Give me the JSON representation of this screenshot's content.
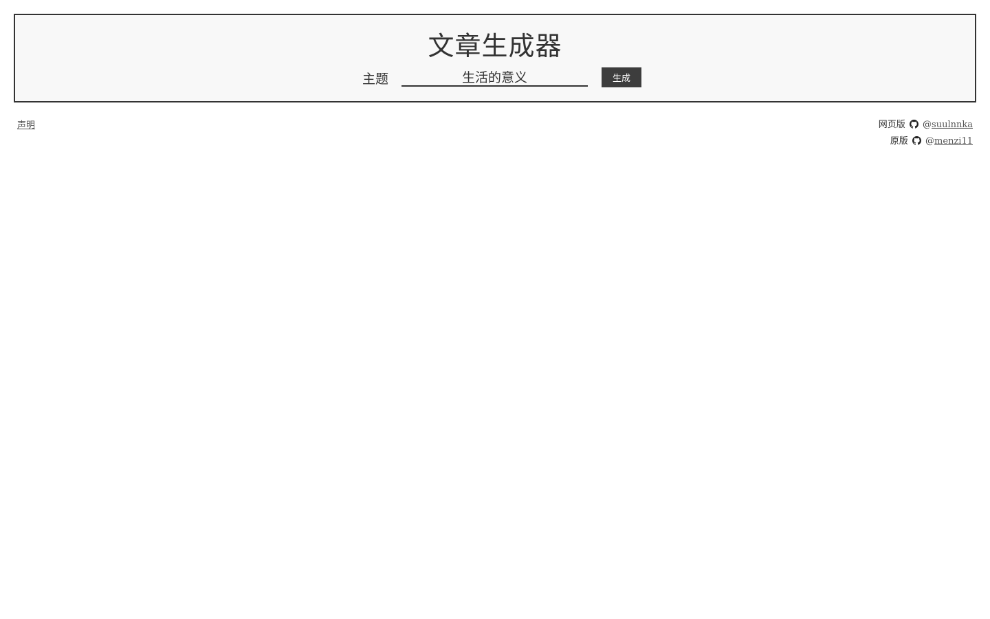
{
  "header": {
    "title": "文章生成器",
    "topic_label": "主题",
    "topic_value": "生活的意义",
    "generate_label": "生成"
  },
  "footer": {
    "disclaimer": "声明",
    "web_version_label": "网页版",
    "web_version_at": "@",
    "web_version_user": "suulnnka",
    "original_label": "原版",
    "original_at": "@",
    "original_user": "menzi11"
  },
  "icons": {
    "credit_icon": "github-icon"
  },
  "colors": {
    "text": "#333333",
    "header_bg": "#f8f8f8",
    "button_bg": "#3d3d3d",
    "button_text": "#ffffff"
  }
}
